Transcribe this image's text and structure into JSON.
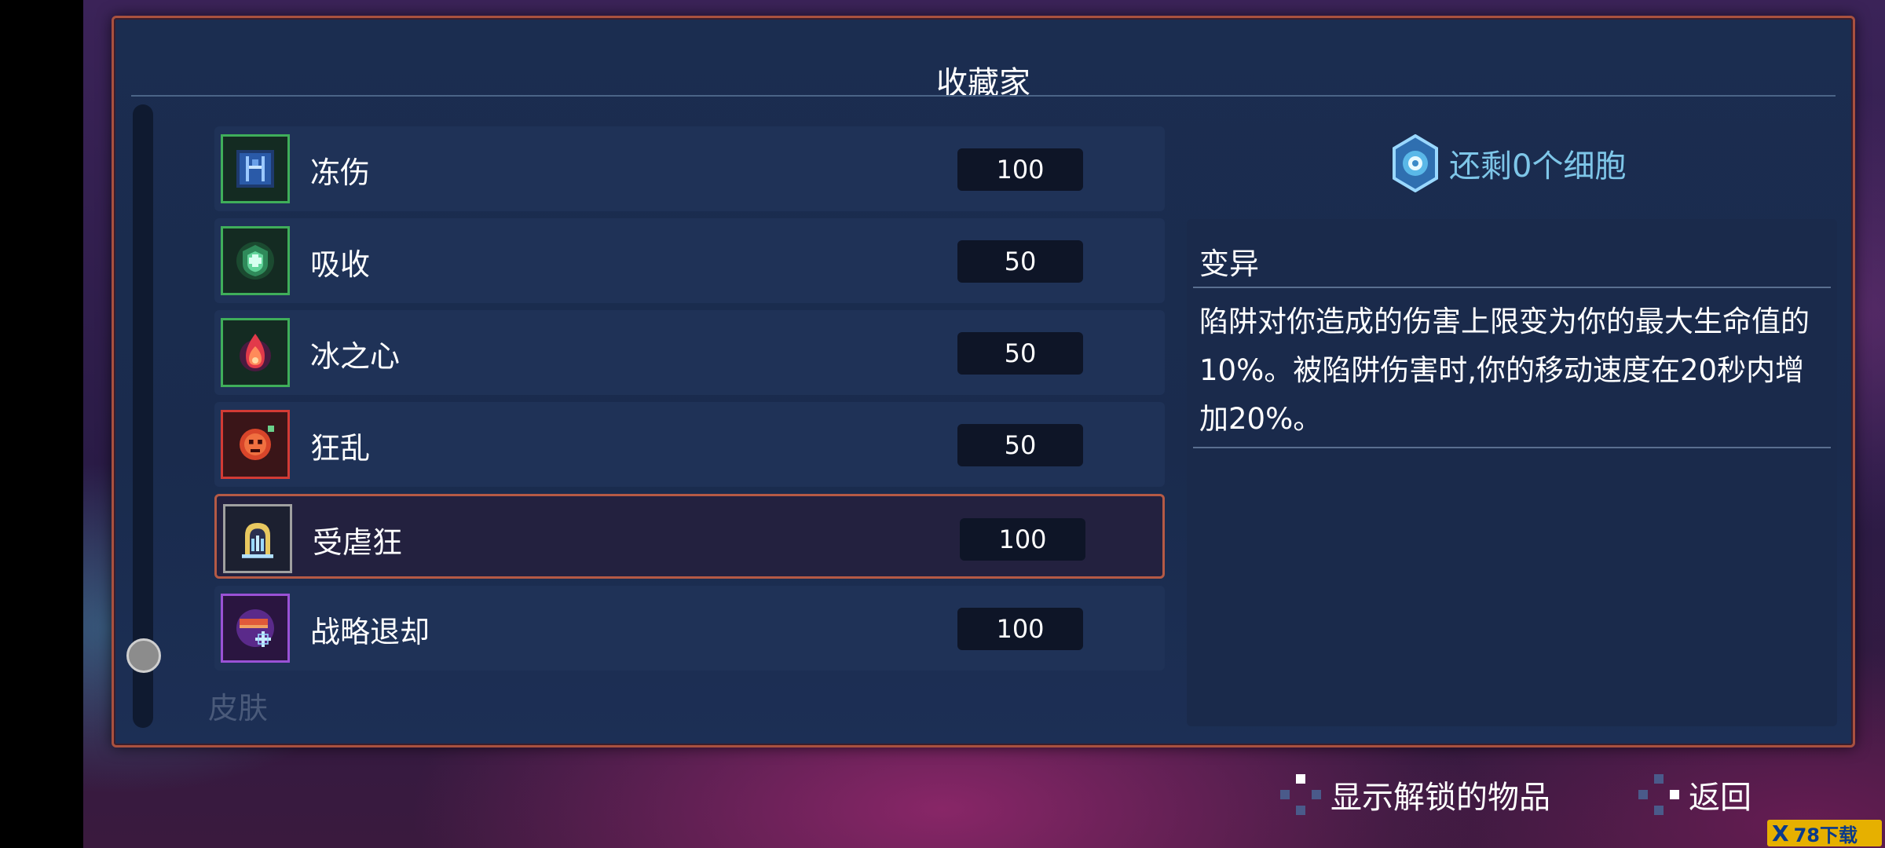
{
  "panel": {
    "title": "收藏家"
  },
  "list": {
    "items": [
      {
        "name": "冻伤",
        "cost": "100",
        "icon": "frostbite-icon",
        "frame_color": "#3fae5a"
      },
      {
        "name": "吸收",
        "cost": "50",
        "icon": "absorb-shield-icon",
        "frame_color": "#3fae5a"
      },
      {
        "name": "冰之心",
        "cost": "50",
        "icon": "ice-heart-flame-icon",
        "frame_color": "#3fae5a"
      },
      {
        "name": "狂乱",
        "cost": "50",
        "icon": "frenzy-icon",
        "frame_color": "#d23b35"
      },
      {
        "name": "受虐狂",
        "cost": "100",
        "icon": "masochist-icon",
        "frame_color": "#a0a0a0",
        "selected": true
      },
      {
        "name": "战略退却",
        "cost": "100",
        "icon": "tactical-retreat-icon",
        "frame_color": "#9a52d6"
      }
    ],
    "next_section": "皮肤"
  },
  "cells": {
    "text": "还剩0个细胞",
    "icon": "cell-icon",
    "color": "#7ec6e8"
  },
  "detail": {
    "title": "变异",
    "description": "陷阱对你造成的伤害上限变为你的最大生命值的10%。被陷阱伤害时,你的移动速度在20秒内增加20%。"
  },
  "footer": {
    "show_unlocked": "显示解锁的物品",
    "back": "返回"
  },
  "watermark": {
    "logo": "X",
    "text": "78下载"
  },
  "colors": {
    "panel_border": "#a9513f",
    "panel_bg": "#1b2d50",
    "selected_border": "#b55a45"
  }
}
